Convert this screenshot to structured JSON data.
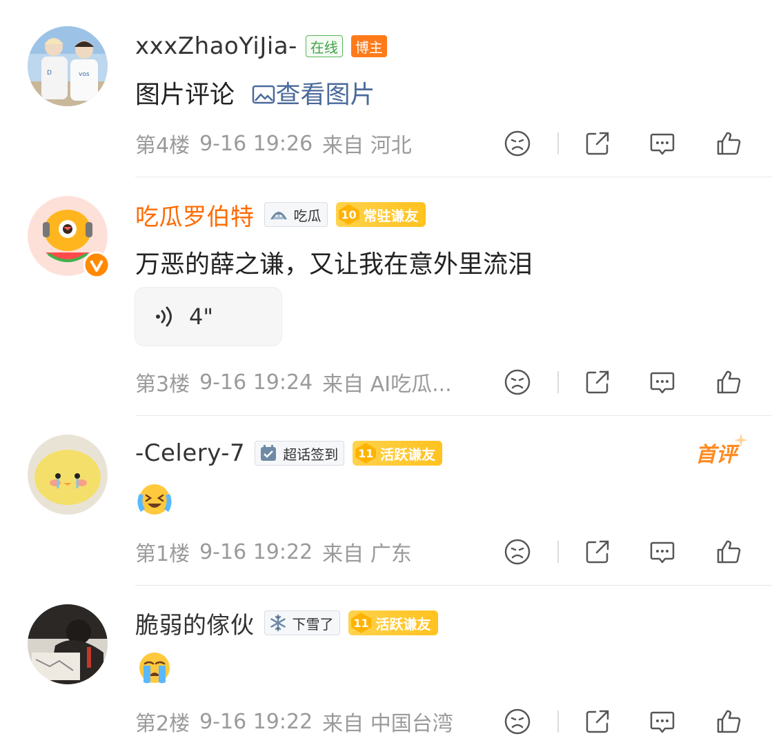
{
  "comments": [
    {
      "username": "xxxZhaoYiJia-",
      "tags": {
        "online": "在线",
        "host": "博主"
      },
      "text": "图片评论",
      "link": "查看图片",
      "meta": {
        "floor": "第4楼",
        "time": "9-16 19:26",
        "source": "来自 河北"
      }
    },
    {
      "username": "吃瓜罗伯特",
      "badge": {
        "icon": "watermelon-icon",
        "label": "吃瓜"
      },
      "fan": {
        "level": "10",
        "label": "常驻谦友"
      },
      "text": "万恶的薛之谦，又让我在意外里流泪",
      "voice": {
        "duration": "4\""
      },
      "meta": {
        "floor": "第3楼",
        "time": "9-16 19:24",
        "source": "来自 AI吃瓜..."
      }
    },
    {
      "username": "-Celery-7",
      "badge": {
        "icon": "checkin-icon",
        "label": "超话签到"
      },
      "fan": {
        "level": "11",
        "label": "活跃谦友"
      },
      "first_comment": "首评",
      "emoji": "laughing-crying-emoji",
      "meta": {
        "floor": "第1楼",
        "time": "9-16 19:22",
        "source": "来自 广东"
      }
    },
    {
      "username": "脆弱的傢伙",
      "badge": {
        "icon": "snowflake-icon",
        "label": "下雪了"
      },
      "fan": {
        "level": "11",
        "label": "活跃谦友"
      },
      "emoji": "loudly-crying-emoji",
      "meta": {
        "floor": "第2楼",
        "time": "9-16 19:22",
        "source": "来自 中国台湾"
      }
    }
  ],
  "actions": [
    "dislike-icon",
    "share-icon",
    "reply-icon",
    "like-icon"
  ],
  "colors": {
    "accent": "#ff6a00",
    "link": "#4a6a9a",
    "meta": "#9a9a9a",
    "fan_badge": "#ffc21f"
  }
}
